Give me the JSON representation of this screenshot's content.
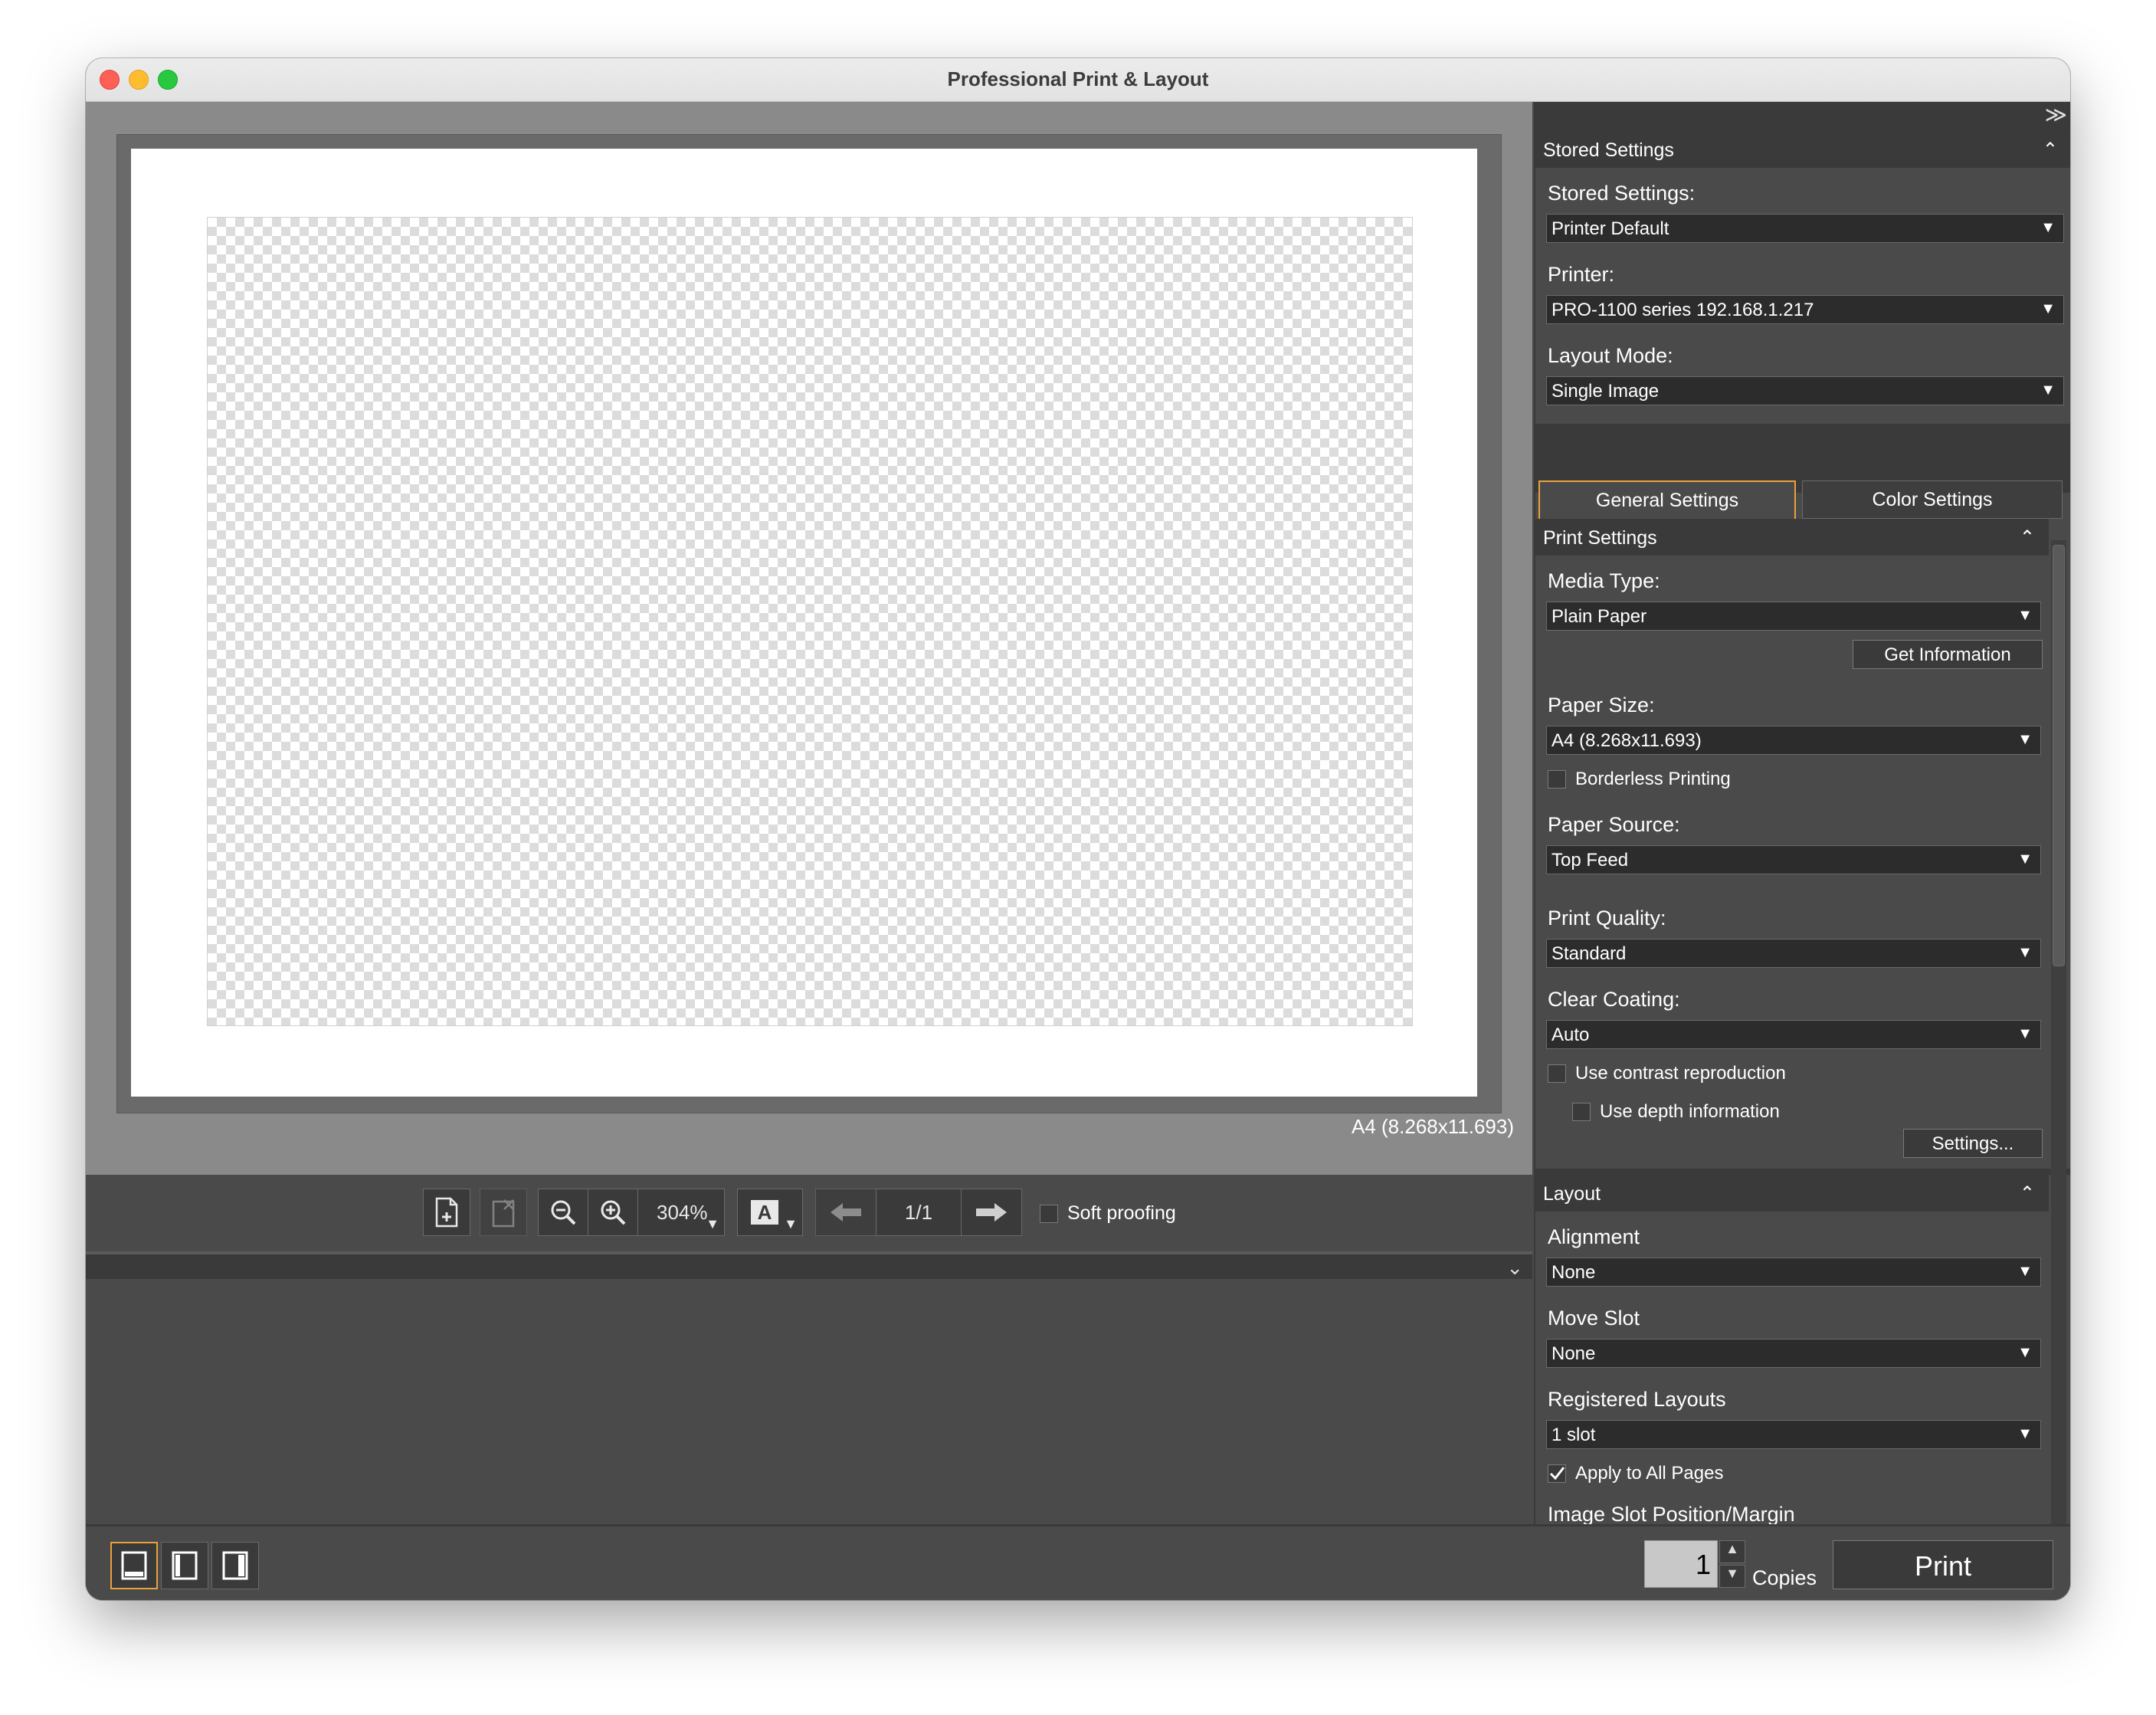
{
  "window": {
    "title": "Professional Print & Layout"
  },
  "preview": {
    "paper_size_label": "A4 (8.268x11.693)"
  },
  "toolbar": {
    "zoom_value": "304%",
    "page_indicator": "1/1",
    "soft_proofing_label": "Soft proofing",
    "font_icon_letter": "A"
  },
  "right_panel": {
    "stored_settings_header": "Stored Settings",
    "stored_settings_label": "Stored Settings:",
    "stored_settings_value": "Printer Default",
    "printer_label": "Printer:",
    "printer_value": "PRO-1100 series 192.168.1.217",
    "layout_mode_label": "Layout Mode:",
    "layout_mode_value": "Single Image",
    "tabs": {
      "general": "General Settings",
      "color": "Color Settings"
    },
    "print_settings_header": "Print Settings",
    "media_type_label": "Media Type:",
    "media_type_value": "Plain Paper",
    "get_information_label": "Get Information",
    "paper_size_label": "Paper Size:",
    "paper_size_value": "A4 (8.268x11.693)",
    "borderless_label": "Borderless Printing",
    "paper_source_label": "Paper Source:",
    "paper_source_value": "Top Feed",
    "print_quality_label": "Print Quality:",
    "print_quality_value": "Standard",
    "clear_coating_label": "Clear Coating:",
    "clear_coating_value": "Auto",
    "contrast_label": "Use contrast reproduction",
    "depth_label": "Use depth information",
    "settings_button": "Settings...",
    "layout_header": "Layout",
    "alignment_label": "Alignment",
    "alignment_value": "None",
    "move_slot_label": "Move Slot",
    "move_slot_value": "None",
    "registered_layouts_label": "Registered Layouts",
    "registered_layouts_value": "1 slot",
    "apply_all_label": "Apply to All Pages",
    "apply_all_checked": true,
    "image_slot_label": "Image Slot Position/Margin"
  },
  "bottom": {
    "copies_value": "1",
    "copies_label": "Copies",
    "print_label": "Print"
  },
  "colors": {
    "accent": "#e9a23b",
    "panel": "#4a4a4a",
    "preview_bg": "#8a8a8a"
  }
}
